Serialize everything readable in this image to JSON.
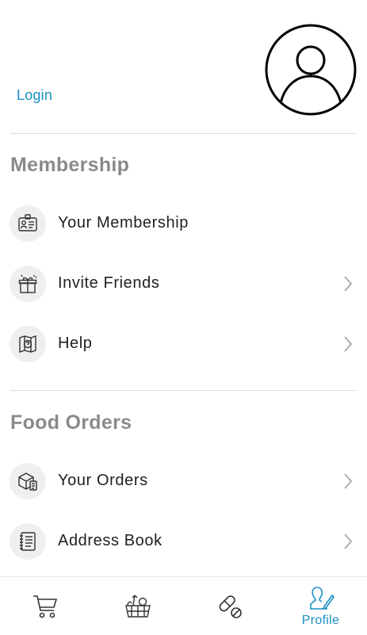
{
  "header": {
    "login_label": "Login",
    "avatar_icon": "user-circle-icon"
  },
  "sections": {
    "membership": {
      "title": "Membership",
      "items": [
        {
          "label": "Your Membership",
          "icon": "id-card-icon",
          "chevron": false
        },
        {
          "label": "Invite Friends",
          "icon": "gift-icon",
          "chevron": true
        },
        {
          "label": "Help",
          "icon": "help-map-icon",
          "chevron": true
        }
      ]
    },
    "food_orders": {
      "title": "Food Orders",
      "items": [
        {
          "label": "Your Orders",
          "icon": "package-icon",
          "chevron": true
        },
        {
          "label": "Address Book",
          "icon": "address-book-icon",
          "chevron": true
        }
      ]
    }
  },
  "tabbar": {
    "tabs": [
      {
        "icon": "cart-icon",
        "label": ""
      },
      {
        "icon": "grocery-basket-icon",
        "label": ""
      },
      {
        "icon": "pill-icon",
        "label": ""
      },
      {
        "icon": "profile-icon",
        "label": "Profile",
        "active": true
      }
    ]
  },
  "colors": {
    "accent": "#1a8fc1",
    "section_title": "#8a8a8a",
    "divider": "#dcdcdc"
  }
}
